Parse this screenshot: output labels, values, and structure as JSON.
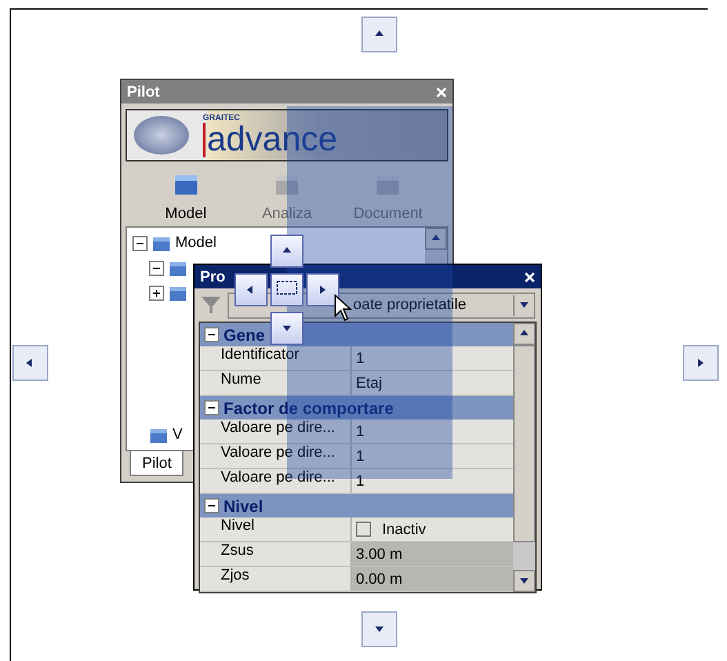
{
  "pilot": {
    "title": "Pilot",
    "logo": {
      "brand": "GRAITEC",
      "name": "advance"
    },
    "tools": [
      {
        "label": "Model",
        "disabled": false
      },
      {
        "label": "Analiza",
        "disabled": true
      },
      {
        "label": "Document",
        "disabled": true
      }
    ],
    "tree": [
      {
        "label": "Model",
        "expanded": true,
        "children": [
          {
            "expanded": true
          },
          {
            "expanded": false
          },
          {
            "label": "V"
          }
        ]
      }
    ],
    "tabs": [
      {
        "label": "Pilot",
        "selected": true
      }
    ]
  },
  "properties": {
    "title": "Pro",
    "filter": "oate proprietatile",
    "groups": [
      {
        "title": "Gene",
        "expanded": true,
        "rows": [
          {
            "name": "Identificator",
            "value": "1",
            "kind": "text"
          },
          {
            "name": "Nume",
            "value": "Etaj",
            "kind": "text"
          }
        ]
      },
      {
        "title": "Factor de comportare",
        "expanded": true,
        "rows": [
          {
            "name": "Valoare pe dire...",
            "value": "1",
            "kind": "text"
          },
          {
            "name": "Valoare pe dire...",
            "value": "1",
            "kind": "text"
          },
          {
            "name": "Valoare pe dire...",
            "value": "1",
            "kind": "text"
          }
        ]
      },
      {
        "title": "Nivel",
        "expanded": true,
        "rows": [
          {
            "name": "Nivel",
            "value": "Inactiv",
            "kind": "checkbox",
            "checked": false
          },
          {
            "name": "Zsus",
            "value": "3.00 m",
            "kind": "readonly"
          },
          {
            "name": "Zjos",
            "value": "0.00 m",
            "kind": "readonly"
          }
        ]
      }
    ]
  }
}
